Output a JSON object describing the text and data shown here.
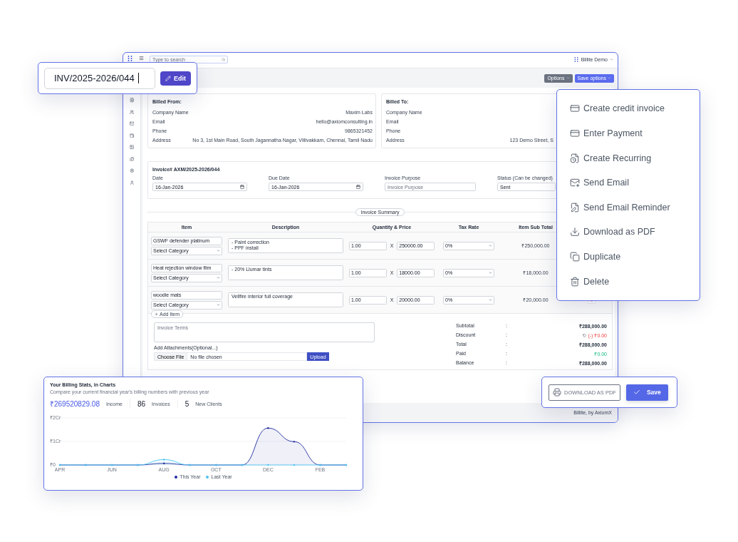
{
  "window": {
    "brand": "Billite Demo",
    "search": {
      "placeholder": "Type to search"
    }
  },
  "toolbar": {
    "buttons": [
      {
        "label": "Options",
        "kind": "secondary"
      },
      {
        "label": "Save options",
        "kind": "primary"
      }
    ]
  },
  "invoice_number": {
    "value": "INV/2025-2026/044",
    "edit_button": "Edit"
  },
  "billed_from": {
    "title": "Billed From:",
    "rows": [
      {
        "label": "Company Name",
        "value": "Maxim Labs"
      },
      {
        "label": "Email",
        "value": "hello@axiomconsulting.in"
      },
      {
        "label": "Phone",
        "value": "9865321452"
      },
      {
        "label": "Address",
        "value": "No 3, 1st Main Road, South Jagannatha Nagar, Villivakkam, Chennai, Tamil Nadu"
      }
    ]
  },
  "billed_to": {
    "title": "Billed To:",
    "rows": [
      {
        "label": "Company Name"
      },
      {
        "label": "Email"
      },
      {
        "label": "Phone"
      },
      {
        "label": "Address",
        "value": "123 Demo Street, S"
      }
    ]
  },
  "invoice": {
    "title": "Invoice# AXM/2025-2026/044",
    "fields": [
      {
        "label": "Date",
        "value": "16-Jan-2026",
        "kind": "date"
      },
      {
        "label": "Due Date",
        "value": "16-Jan-2026",
        "kind": "date"
      },
      {
        "label": "Invoice Purpose",
        "placeholder": "Invoice Purpose",
        "kind": "text"
      },
      {
        "label": "Status",
        "note": "(Can be changed)",
        "value": "Sent",
        "kind": "select"
      }
    ]
  },
  "summary_label": "Invoice Summary",
  "table": {
    "columns": [
      "Item",
      "Description",
      "Quantity & Price",
      "Tax Rate",
      "Item Sub Total"
    ],
    "rows": [
      {
        "item": "GSWF defender platinum",
        "category": "Select Category",
        "description": "- Paint correction\n- PPF install",
        "quantity": "1.00",
        "times": "X",
        "price": "250000.00",
        "tax": "0%",
        "subtotal": "₹250,000.00",
        "delete": false
      },
      {
        "item": "Heat rejection window film",
        "category": "Select Category",
        "description": "- 20% Llumar tints",
        "quantity": "1.00",
        "times": "X",
        "price": "18000.00",
        "tax": "0%",
        "subtotal": "₹18,000.00",
        "delete": false
      },
      {
        "item": "woodie mats",
        "category": "Select Category",
        "description": "Vellfire interior full coverage",
        "quantity": "1.00",
        "times": "X",
        "price": "20000.00",
        "tax": "0%",
        "subtotal": "₹20,000.00",
        "delete": true
      }
    ]
  },
  "add_item": "Add Item",
  "terms": {
    "placeholder": "Invoice Terms"
  },
  "attachments": {
    "label": "Add Attachments(Optional...)",
    "choose": "Choose File",
    "file": "No file chosen",
    "upload": "Upload"
  },
  "totals": [
    {
      "label": "Subtotal",
      "sep": ":",
      "value": "₹288,000.00",
      "kind": "plain"
    },
    {
      "label": "Discount",
      "sep": ":",
      "value": "(-) ₹0.00",
      "kind": "discount"
    },
    {
      "label": "Total",
      "sep": ":",
      "value": "₹288,000.00",
      "kind": "plain"
    },
    {
      "label": "Paid",
      "sep": ":",
      "value": "₹0.00",
      "kind": "paid"
    },
    {
      "label": "Balance",
      "sep": ":",
      "value": "₹288,000.00",
      "kind": "plain"
    }
  ],
  "footer": "Billite, by AxiomX",
  "menu": {
    "items": [
      "Create credit invoice",
      "Enter Payment",
      "Create Recurring",
      "Send Email",
      "Send Email Reminder",
      "Download as PDF",
      "Duplicate",
      "Delete"
    ]
  },
  "actions": {
    "download": "DOWNLOAD AS PDF",
    "save": "Save"
  },
  "stats": {
    "title": "Your Billing Stats, in Charts",
    "subtitle": "Compare your current financial year's billing numbers with previous year",
    "figures": [
      {
        "value": "₹269520829.08",
        "label": "Income",
        "kind": "money"
      },
      {
        "value": "86",
        "label": "Invoices",
        "kind": "count"
      },
      {
        "value": "5",
        "label": "New Clients",
        "kind": "count"
      }
    ],
    "chart_data": {
      "type": "area",
      "categories": [
        "APR",
        null,
        "JUN",
        null,
        "AUG",
        null,
        "OCT",
        null,
        "DEC",
        null,
        "FEB",
        null
      ],
      "yticks": [
        {
          "value": 0,
          "label": "₹0"
        },
        {
          "value": 1,
          "label": "₹1Cr"
        },
        {
          "value": 2,
          "label": "₹2Cr"
        }
      ],
      "ylim": [
        0,
        2
      ],
      "series": [
        {
          "name": "This Year",
          "color": "#1e2a9e",
          "values": [
            0,
            0,
            0,
            0,
            0.07,
            0,
            0,
            0,
            1.57,
            0.99,
            0,
            0
          ]
        },
        {
          "name": "Last Year",
          "color": "#4cc3f5",
          "values": [
            0,
            0,
            0,
            0,
            0.23,
            0,
            0,
            0,
            0,
            0,
            0,
            0
          ]
        }
      ]
    }
  }
}
